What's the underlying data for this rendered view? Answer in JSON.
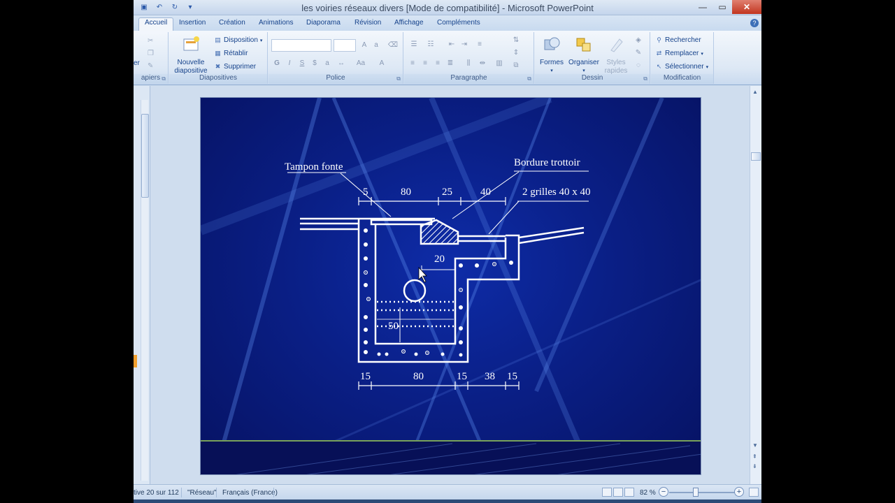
{
  "window": {
    "title": "les voiries réseaux divers [Mode de compatibilité] - Microsoft PowerPoint",
    "controls": {
      "minimize": "—",
      "maximize": "▭",
      "close": "✕"
    }
  },
  "quick_access": {
    "save_icon": "save-icon",
    "undo_icon": "undo-icon",
    "redo_icon": "redo-icon",
    "customize": "▾"
  },
  "tabs": [
    "Accueil",
    "Insertion",
    "Création",
    "Animations",
    "Diaporama",
    "Révision",
    "Affichage",
    "Compléments"
  ],
  "active_tab": "Accueil",
  "ribbon": {
    "clipboard": {
      "label": "apiers",
      "paste_fragment": "er"
    },
    "slides": {
      "label": "Diapositives",
      "new_slide_line1": "Nouvelle",
      "new_slide_line2": "diapositive",
      "disposition": "Disposition",
      "retablir": "Rétablir",
      "supprimer": "Supprimer"
    },
    "font": {
      "label": "Police"
    },
    "paragraph": {
      "label": "Paragraphe"
    },
    "drawing": {
      "label": "Dessin",
      "formes": "Formes",
      "organiser": "Organiser",
      "styles_line1": "Styles",
      "styles_line2": "rapides"
    },
    "editing": {
      "label": "Modification",
      "rechercher": "Rechercher",
      "remplacer": "Remplacer",
      "selectionner": "Sélectionner"
    }
  },
  "slide": {
    "labels": {
      "tampon": "Tampon fonte",
      "bordure": "Bordure trottoir",
      "grilles": "2 grilles 40 x 40"
    },
    "top_dimensions": [
      "5",
      "80",
      "25",
      "40"
    ],
    "inner_dimensions": {
      "step": "20",
      "depth": "50"
    },
    "bottom_dimensions": [
      "15",
      "80",
      "15",
      "38",
      "15"
    ]
  },
  "status": {
    "slide_position": "tive 20 sur 112",
    "theme": "\"Réseau\"",
    "language": "Français (France)",
    "zoom": "82 %",
    "zoom_minus": "−",
    "zoom_plus": "+"
  },
  "colors": {
    "slide_background": "#0a1f86",
    "drawing": "#ffffff",
    "accent_line": "#9fd35a"
  }
}
